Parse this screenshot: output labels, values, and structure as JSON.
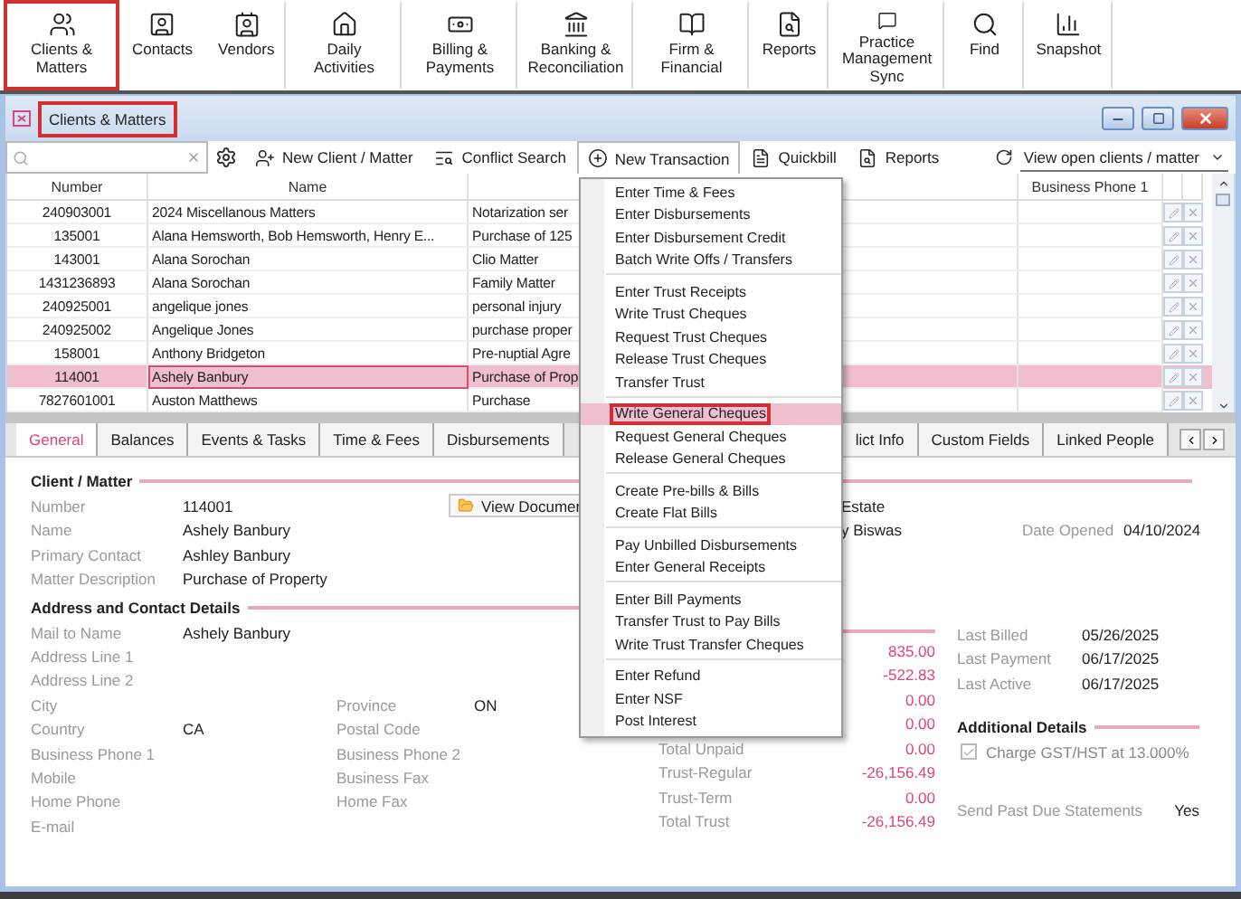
{
  "ribbon": [
    {
      "label": "Clients & Matters",
      "selected": true
    },
    {
      "label": "Contacts",
      "selected": false
    },
    {
      "label": "Vendors",
      "selected": false
    },
    {
      "label": "Daily Activities",
      "selected": false
    },
    {
      "label": "Billing & Payments",
      "selected": false
    },
    {
      "label": "Banking & Reconciliation",
      "selected": false
    },
    {
      "label": "Firm & Financial",
      "selected": false
    },
    {
      "label": "Reports",
      "selected": false
    },
    {
      "label": "Practice Management Sync",
      "selected": false
    },
    {
      "label": "Find",
      "selected": false
    },
    {
      "label": "Snapshot",
      "selected": false
    }
  ],
  "window": {
    "title": "Clients & Matters"
  },
  "toolbar": {
    "buttons": [
      {
        "label": "New Client / Matter",
        "pressed": false
      },
      {
        "label": "Conflict Search",
        "pressed": false
      },
      {
        "label": "New Transaction",
        "pressed": true
      },
      {
        "label": "Quickbill",
        "pressed": false
      },
      {
        "label": "Reports",
        "pressed": false
      }
    ],
    "view_filter": "View open clients / matter"
  },
  "table": {
    "columns": [
      "Number",
      "Name",
      "Business Phone 1"
    ],
    "rows": [
      {
        "number": "240903001",
        "name": "2024 Miscellanous Matters",
        "column_3": "Notarization ser",
        "selected": false
      },
      {
        "number": "135001",
        "name": "Alana Hemsworth, Bob Hemsworth, Henry E...",
        "column_3": "Purchase of 125",
        "selected": false
      },
      {
        "number": "143001",
        "name": "Alana Sorochan",
        "column_3": "Clio Matter",
        "selected": false
      },
      {
        "number": "1431236893",
        "name": "Alana Sorochan",
        "column_3": "Family Matter",
        "selected": false
      },
      {
        "number": "240925001",
        "name": "angelique jones",
        "column_3": "personal injury",
        "selected": false
      },
      {
        "number": "240925002",
        "name": "Angelique Jones",
        "column_3": "purchase proper",
        "selected": false
      },
      {
        "number": "158001",
        "name": "Anthony Bridgeton",
        "column_3": "Pre-nuptial Agre",
        "selected": false
      },
      {
        "number": "114001",
        "name": "Ashely Banbury",
        "column_3": "Purchase of Prop",
        "selected": true
      },
      {
        "number": "7827601001",
        "name": "Auston Matthews",
        "column_3": "Purchase",
        "selected": false
      }
    ]
  },
  "tabs": [
    {
      "label": "General",
      "selected": true
    },
    {
      "label": "Balances",
      "selected": false
    },
    {
      "label": "Events & Tasks",
      "selected": false
    },
    {
      "label": "Time & Fees",
      "selected": false
    },
    {
      "label": "Disbursements",
      "selected": false
    },
    {
      "label": "lict Info",
      "selected": false
    },
    {
      "label": "Custom Fields",
      "selected": false
    },
    {
      "label": "Linked People",
      "selected": false
    }
  ],
  "client_matter": {
    "heading": "Client / Matter",
    "button": "View Documer",
    "fields": [
      {
        "label": "Number",
        "value": "114001",
        "column_3": "Estate"
      },
      {
        "label": "Name",
        "value": "Ashely Banbury",
        "column_3": "y Biswas",
        "label_2": "Date Opened",
        "value_2": "04/10/2024"
      },
      {
        "label": "Primary Contact",
        "value": "Ashley Banbury"
      },
      {
        "label": "Matter Description",
        "value": "Purchase of Property"
      }
    ]
  },
  "address": {
    "heading": "Address and Contact Details",
    "fields": [
      {
        "label": "Mail to Name",
        "value": "Ashely Banbury"
      },
      {
        "label": "Address Line 1"
      },
      {
        "label": "Address Line 2"
      },
      {
        "label": "City",
        "label_2": "Province",
        "value_2": "ON"
      },
      {
        "label": "Country",
        "value": "CA",
        "label_2": "Postal Code"
      },
      {
        "label": "Business Phone 1",
        "label_2": "Business Phone 2"
      },
      {
        "label": "Mobile",
        "label_2": "Business Fax"
      },
      {
        "label": "Home Phone",
        "label_2": "Home Fax"
      },
      {
        "label": "E-mail"
      }
    ]
  },
  "balances": [
    {
      "amount": "835.00"
    },
    {
      "amount": "-522.83"
    },
    {
      "amount": "0.00"
    },
    {
      "amount": "0.00"
    },
    {
      "label": "Total Unpaid",
      "amount": "0.00"
    },
    {
      "label": "Trust-Regular",
      "amount": "-26,156.49"
    },
    {
      "label": "Trust-Term",
      "amount": "0.00"
    },
    {
      "label": "Total Trust",
      "amount": "-26,156.49"
    }
  ],
  "dates": [
    {
      "label": "Last Billed",
      "value": "05/26/2025"
    },
    {
      "label": "Last Payment",
      "value": "06/17/2025"
    },
    {
      "label": "Last Active",
      "value": "06/17/2025"
    }
  ],
  "additional": {
    "heading": "Additional Details",
    "checkbox": {
      "label": "Charge GST/HST at 13.000%",
      "checked": true,
      "disabled": true
    },
    "send_past_due": {
      "label": "Send Past Due Statements",
      "value": "Yes"
    }
  },
  "menu": [
    [
      {
        "label": "Enter Time & Fees",
        "selected": false
      },
      {
        "label": "Enter Disbursements",
        "selected": false
      },
      {
        "label": "Enter Disbursement Credit",
        "selected": false
      },
      {
        "label": "Batch Write Offs / Transfers",
        "selected": false
      }
    ],
    [
      {
        "label": "Enter Trust Receipts",
        "selected": false
      },
      {
        "label": "Write Trust Cheques",
        "selected": false
      },
      {
        "label": "Request Trust Cheques",
        "selected": false
      },
      {
        "label": "Release Trust Cheques",
        "selected": false
      },
      {
        "label": "Transfer Trust",
        "selected": false
      }
    ],
    [
      {
        "label": "Write General Cheques",
        "selected": true
      },
      {
        "label": "Request General Cheques",
        "selected": false
      },
      {
        "label": "Release General Cheques",
        "selected": false
      }
    ],
    [
      {
        "label": "Create Pre-bills & Bills",
        "selected": false
      },
      {
        "label": "Create Flat Bills",
        "selected": false
      }
    ],
    [
      {
        "label": "Pay Unbilled Disbursements",
        "selected": false
      },
      {
        "label": "Enter General Receipts",
        "selected": false
      }
    ],
    [
      {
        "label": "Enter Bill Payments",
        "selected": false
      },
      {
        "label": "Transfer Trust to Pay Bills",
        "selected": false
      },
      {
        "label": "Write Trust Transfer Cheques",
        "selected": false
      }
    ],
    [
      {
        "label": "Enter Refund",
        "selected": false
      },
      {
        "label": "Enter NSF",
        "selected": false
      },
      {
        "label": "Post Interest",
        "selected": false
      }
    ]
  ]
}
